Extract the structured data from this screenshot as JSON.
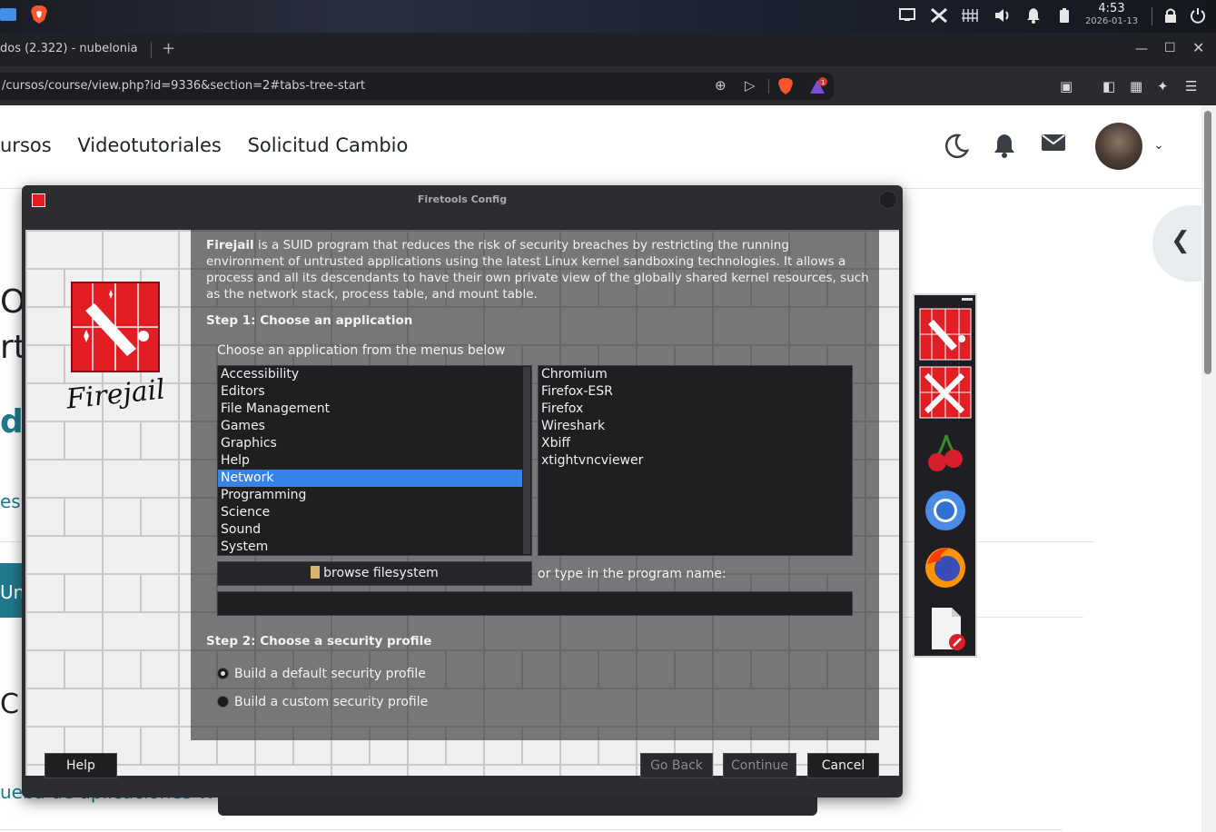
{
  "system_panel": {
    "time": "4:53",
    "date": "2026-01-13"
  },
  "browser": {
    "tab_title": "dos (2.322) - nubelonia",
    "new_tab": "+",
    "url": "/cursos/course/view.php?id=9336&section=2#tabs-tree-start"
  },
  "webpage": {
    "nav": [
      "ursos",
      "Videotutoriales",
      "Solicitud Cambio"
    ],
    "fragments": [
      "O",
      "rt",
      "du",
      "es",
      "Un",
      "C",
      "ueba de aplicaciones W"
    ]
  },
  "firetools": {
    "title": "Firetools Config",
    "logo_text": "Firejail",
    "intro_bold": "Firejail",
    "intro_rest": " is a SUID program that reduces the risk of security breaches by restricting the running environment of untrusted applications using the latest Linux kernel sandboxing technologies. It allows a process and all its descendants to have their own private view of the globally shared kernel resources, such as the network stack, process table, and mount table.",
    "step1": "Step 1: Choose an application",
    "choose_label": "Choose an application from the menus below",
    "categories": [
      "Accessibility",
      "Editors",
      "File Management",
      "Games",
      "Graphics",
      "Help",
      "Network",
      "Programming",
      "Science",
      "Sound",
      "System"
    ],
    "selected_category": "Network",
    "apps": [
      "Chromium",
      "Firefox-ESR",
      "Firefox",
      "Wireshark",
      "Xbiff",
      "xtightvncviewer"
    ],
    "browse_label": "browse filesystem",
    "type_label": "or type in the program name:",
    "program_value": "",
    "step2": "Step 2: Choose a security profile",
    "radio_default": "Build a default security profile",
    "radio_custom": "Build a custom security profile",
    "selected_profile": "default",
    "buttons": {
      "help": "Help",
      "go_back": "Go Back",
      "continue": "Continue",
      "cancel": "Cancel"
    }
  },
  "launcher": {
    "icons": [
      "firejail-icon",
      "firetools-config-icon",
      "cherry-icon",
      "chromium-icon",
      "firefox-icon",
      "document-edit-icon"
    ]
  },
  "colors": {
    "firejail_red": "#e21e24",
    "selection_blue": "#3582e8",
    "link_teal": "#1f7a8c"
  }
}
